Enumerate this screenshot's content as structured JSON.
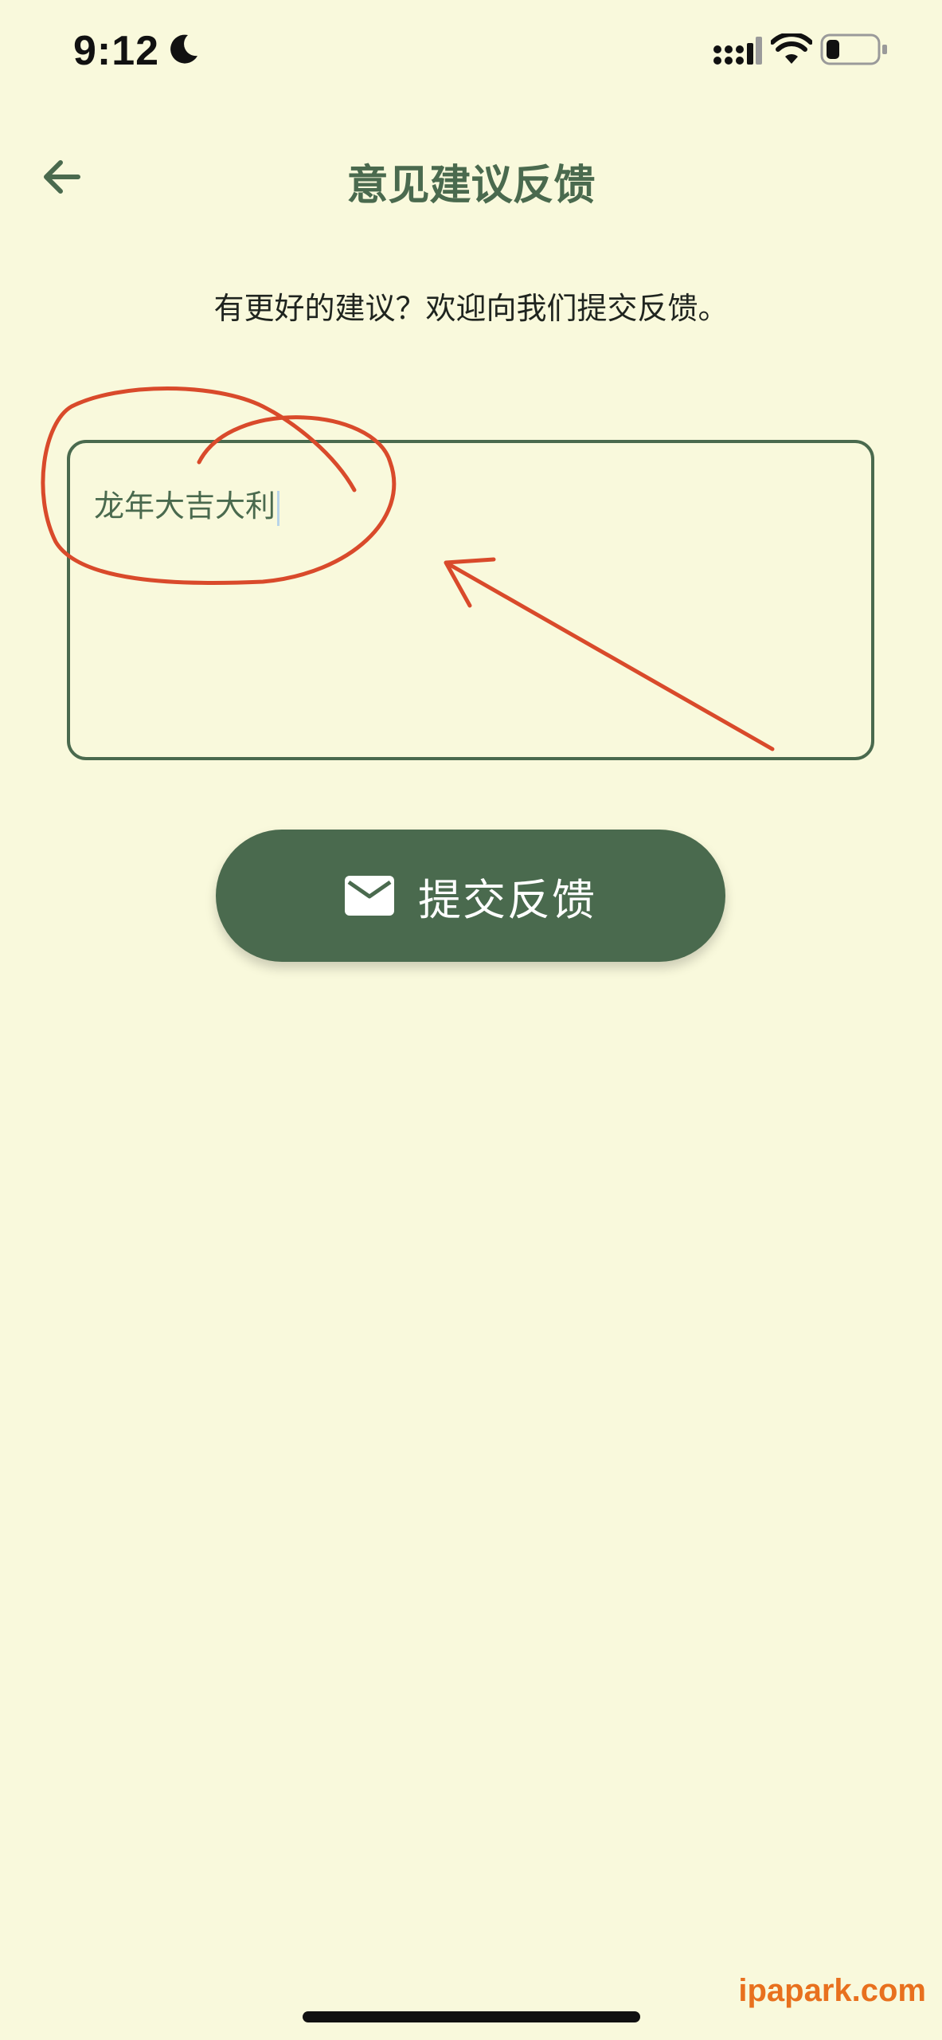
{
  "status_bar": {
    "time": "9:12",
    "icons": [
      "moon-icon",
      "signal-icon",
      "wifi-icon",
      "battery-icon"
    ]
  },
  "header": {
    "title": "意见建议反馈",
    "back_icon": "arrow-left-icon"
  },
  "subtitle": "有更好的建议？欢迎向我们提交反馈。",
  "feedback": {
    "value": "龙年大吉大利"
  },
  "submit": {
    "label": "提交反馈",
    "icon": "mail-icon"
  },
  "watermark": "ipapark.com",
  "colors": {
    "background": "#f9f9dc",
    "accent": "#4a6a4e",
    "annotation": "#d94a2b",
    "watermark": "#e8701e"
  }
}
